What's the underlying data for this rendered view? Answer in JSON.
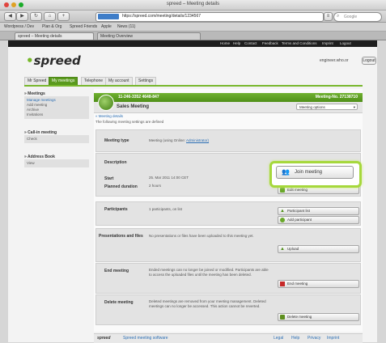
{
  "window": {
    "title": "spreed – Meeting details"
  },
  "browser": {
    "url": "https://spreed.com/meeting/details/1234567",
    "search_placeholder": "Google",
    "bookmarks": [
      "Wordpress / Dev",
      "Plan & Org",
      "Spreed Friends",
      "Apple",
      "News (11)"
    ],
    "tabs": [
      "spreed – Meeting details",
      "Meeting Overview"
    ]
  },
  "page": {
    "topbar": {
      "links": [
        "Home",
        "Help",
        "Contact",
        "Feedback",
        "Terms and Conditions",
        "Imprint",
        "Logout"
      ]
    },
    "logo": {
      "text": "spreed"
    },
    "user": {
      "name": "engineer.who.or",
      "logout": "Logout"
    },
    "nav_tabs": [
      "Mr Spreed",
      "My meetings",
      "Telephone",
      "My account",
      "Settings"
    ],
    "sidebar": {
      "sections": [
        {
          "title": "Meetings",
          "items": [
            "Manage meetings",
            "Add meeting",
            "Archive",
            "Invitations"
          ]
        },
        {
          "title": "Call-in meeting",
          "items": [
            "Check"
          ]
        },
        {
          "title": "Address Book",
          "items": [
            "View"
          ]
        }
      ]
    },
    "meeting": {
      "code": "11-246-3352 4648-847",
      "id": "Meeting-No. 27138710",
      "title": "Sales Meeting",
      "options_label": "Meeting options",
      "back_link": "« Meeting details",
      "intro": "The following meeting settings are defined",
      "sections": {
        "type": {
          "label": "Meeting type",
          "value": "Meeting (using Online: ",
          "value_link": "Administrator)"
        },
        "description": {
          "label": "Description",
          "value": ""
        },
        "start": {
          "label": "Start",
          "value": "25. Mar 2011 14:00 CET"
        },
        "duration": {
          "label": "Planned duration",
          "value": "2 hours"
        },
        "participants": {
          "label": "Participants",
          "value": "1 participants, on list"
        },
        "presentations": {
          "label": "Presentations and files",
          "value": "No presentations or files have been uploaded to this meeting yet."
        },
        "end": {
          "label": "End meeting",
          "value": "Ended meetings can no longer be joined or modified. Participants are able to access the uploaded files until the meeting has been deleted."
        },
        "delete": {
          "label": "Delete meeting",
          "value": "Deleted meetings are removed from your meeting management. Deleted meetings can no longer be accessed. This action cannot be reverted."
        }
      },
      "buttons": {
        "join": "Join meeting",
        "edit": "Edit meeting",
        "invite": "Participant list",
        "add": "Add participant",
        "upload": "Upload",
        "end": "End meeting",
        "delete": "Delete meeting"
      }
    },
    "footer": {
      "logo": "spreed",
      "text": "Spreed meeting software",
      "links": [
        "Legal",
        "Help",
        "Privacy",
        "Imprint"
      ]
    }
  },
  "colors": {
    "accent_green": "#5a9a1d",
    "highlight": "#a6d83c",
    "delete_red": "#c62828"
  },
  "icons": {
    "join": "people-icon",
    "end": "stop-icon",
    "delete": "trash-icon"
  }
}
